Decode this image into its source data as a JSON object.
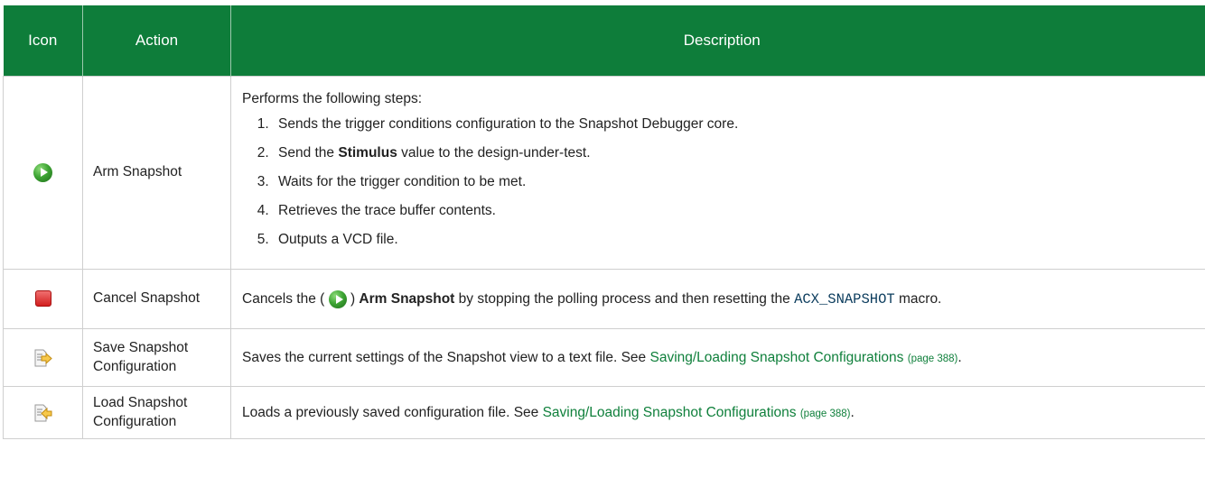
{
  "headers": {
    "icon": "Icon",
    "action": "Action",
    "description": "Description"
  },
  "rows": [
    {
      "icon": "arm-snapshot-icon",
      "action": "Arm Snapshot",
      "intro": "Performs the following steps:",
      "steps": [
        "Sends the trigger conditions configuration to the Snapshot Debugger core.",
        {
          "pre": "Send the ",
          "bold": "Stimulus",
          "post": " value to the design-under-test."
        },
        "Waits for the trigger condition to be met.",
        "Retrieves the trace buffer contents.",
        "Outputs a VCD file."
      ]
    },
    {
      "icon": "stop-icon",
      "action": "Cancel Snapshot",
      "desc_pre": "Cancels the ( ",
      "desc_mid": " ) ",
      "desc_bold": "Arm Snapshot",
      "desc_post1": " by stopping the polling process and then resetting the ",
      "desc_code": "ACX_SNAPSHOT",
      "desc_post2": " macro."
    },
    {
      "icon": "save-config-icon",
      "action_l1": "Save Snapshot",
      "action_l2": "Configuration",
      "desc_text": "Saves the current settings of the Snapshot view to a text file. See ",
      "link": "Saving/Loading Snapshot Configurations",
      "pageref": "(page 388)",
      "end": "."
    },
    {
      "icon": "load-config-icon",
      "action_l1": "Load Snapshot",
      "action_l2": "Configuration",
      "desc_text": "Loads a previously saved configuration file. See ",
      "link": "Saving/Loading Snapshot Configurations",
      "pageref": "(page 388)",
      "end": "."
    }
  ],
  "colors": {
    "header_bg": "#0e7d3a",
    "link": "#10803c"
  }
}
